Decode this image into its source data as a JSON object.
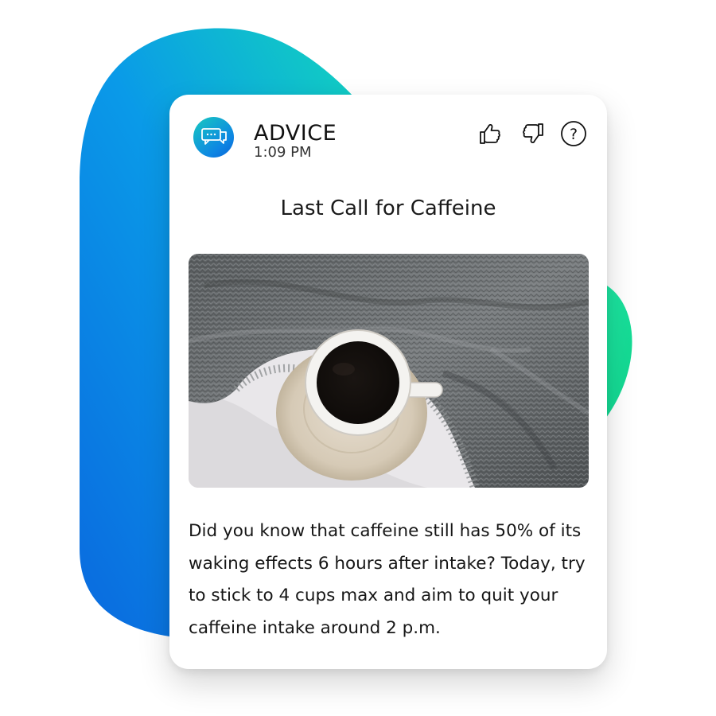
{
  "card": {
    "category": "ADVICE",
    "time": "1:09 PM",
    "title": "Last Call for Caffeine",
    "body": "Did you know that caffeine still has 50% of its waking effects 6 hours after intake? Today, try to stick to 4 cups max and aim to quit your caffeine intake around 2 p.m.",
    "avatar_icon": "chat-bubble-icon",
    "image_subject": "coffee-cup-on-knit-blanket"
  },
  "actions": [
    {
      "name": "thumbs-up-icon"
    },
    {
      "name": "thumbs-down-icon"
    },
    {
      "name": "help-icon",
      "glyph": "?"
    }
  ],
  "colors": {
    "gradient_blue": "#0a7fe0",
    "gradient_teal": "#16d3b5",
    "accent_green": "#1ee59a",
    "text": "#111111"
  }
}
